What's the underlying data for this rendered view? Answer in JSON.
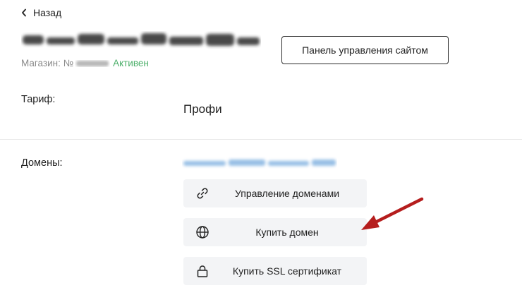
{
  "nav": {
    "back_label": "Назад"
  },
  "shop": {
    "prefix": "Магазин: №",
    "status": "Активен",
    "status_color": "#4caf6a"
  },
  "header": {
    "panel_button_label": "Панель управления сайтом"
  },
  "tariff": {
    "label": "Тариф:",
    "value": "Профи"
  },
  "domains": {
    "label": "Домены:",
    "actions": [
      {
        "label": "Управление доменами",
        "icon": "link-icon"
      },
      {
        "label": "Купить домен",
        "icon": "globe-icon"
      },
      {
        "label": "Купить SSL сертификат",
        "icon": "lock-icon"
      }
    ]
  },
  "annotation": {
    "arrow_color": "#b51d1d",
    "points_to": "Купить домен"
  }
}
